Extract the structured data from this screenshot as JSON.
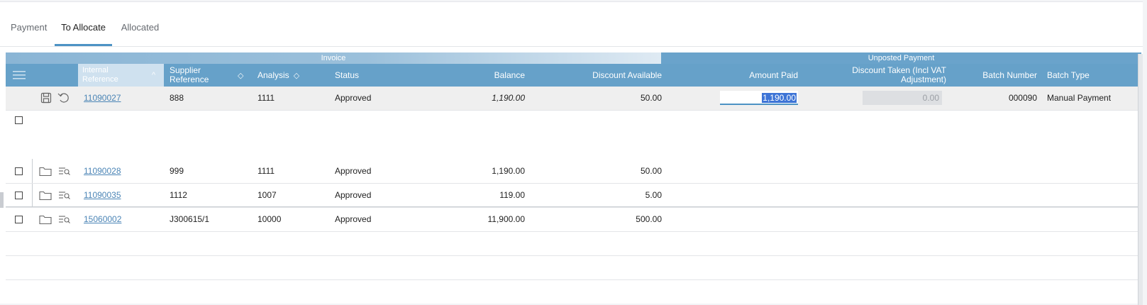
{
  "tabs": [
    {
      "label": "Payment"
    },
    {
      "label": "To Allocate"
    },
    {
      "label": "Allocated"
    }
  ],
  "group_headers": {
    "invoice": "Invoice",
    "unposted_payment": "Unposted Payment"
  },
  "columns": {
    "internal_reference": "Internal Reference",
    "supplier_reference": "Supplier Reference",
    "analysis": "Analysis",
    "status": "Status",
    "balance": "Balance",
    "discount_available": "Discount Available",
    "amount_paid": "Amount Paid",
    "discount_taken": "Discount Taken (Incl VAT Adjustment)",
    "batch_number": "Batch Number",
    "batch_type": "Batch Type"
  },
  "edit_row": {
    "internal_reference": "11090027",
    "supplier_reference": "888",
    "analysis": "1111",
    "status": "Approved",
    "balance": "1,190.00",
    "discount_available": "50.00",
    "amount_paid": "1,190.00",
    "discount_taken": "0.00",
    "batch_number": "000090",
    "batch_type": "Manual Payment"
  },
  "rows": [
    {
      "internal_reference": "11090028",
      "supplier_reference": "999",
      "analysis": "1111",
      "status": "Approved",
      "balance": "1,190.00",
      "discount_available": "50.00"
    },
    {
      "internal_reference": "11090035",
      "supplier_reference": "1112",
      "analysis": "1007",
      "status": "Approved",
      "balance": "119.00",
      "discount_available": "5.00"
    },
    {
      "internal_reference": "15060002",
      "supplier_reference": "J300615/1",
      "analysis": "10000",
      "status": "Approved",
      "balance": "11,900.00",
      "discount_available": "500.00"
    }
  ],
  "colors": {
    "accent": "#4d93c4",
    "header_bg": "#66a1c9",
    "link": "#4b85b6",
    "selection": "#3d74d6"
  }
}
